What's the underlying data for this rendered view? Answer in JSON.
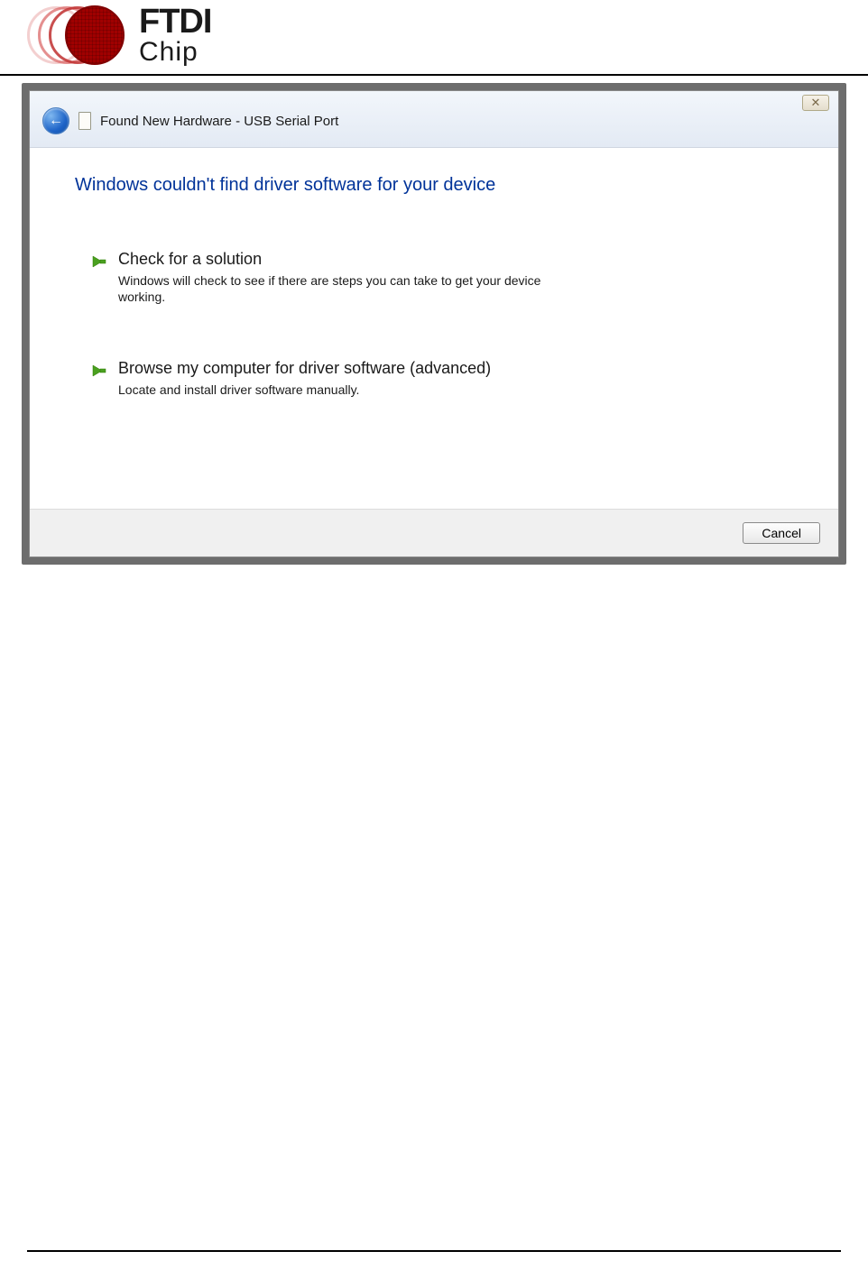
{
  "logo": {
    "line1": "FTDI",
    "line2": "Chip"
  },
  "dialog": {
    "close_glyph": "✕",
    "back_glyph": "←",
    "title": "Found New Hardware - USB Serial Port",
    "heading": "Windows couldn't find driver software for your device",
    "options": [
      {
        "title": "Check for a solution",
        "desc": "Windows will check to see if there are steps you can take to get your device working."
      },
      {
        "title": "Browse my computer for driver software (advanced)",
        "desc": "Locate and install driver software manually."
      }
    ],
    "cancel_label": "Cancel"
  }
}
